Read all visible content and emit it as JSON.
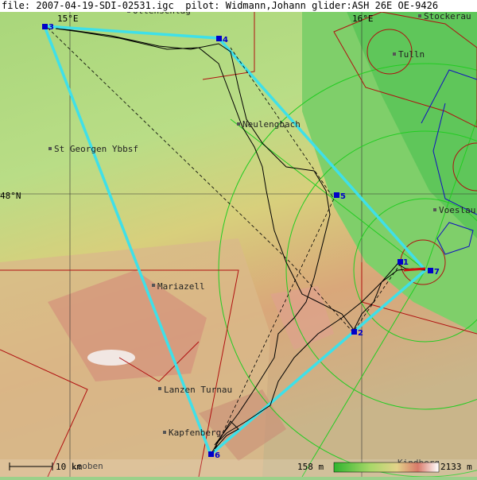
{
  "header": {
    "file_text": "file: 2007-04-19-SDI-02531.igc  pilot: Widmann,Johann glider:ASH 26E OE-9426"
  },
  "coordinates": {
    "lon_15": "15°E",
    "lon_16": "16°E",
    "lat_48": "48°N"
  },
  "towns": [
    {
      "name": "Ottenschlag"
    },
    {
      "name": "Stockerau"
    },
    {
      "name": "Tulln"
    },
    {
      "name": "Neulengbach"
    },
    {
      "name": "St Georgen Ybbsf"
    },
    {
      "name": "Voeslau"
    },
    {
      "name": "Mariazell"
    },
    {
      "name": "Lanzen Turnau"
    },
    {
      "name": "Kapfenberg"
    },
    {
      "name": "Leoben"
    },
    {
      "name": "Kindberg"
    }
  ],
  "turnpoints": [
    {
      "label": "1"
    },
    {
      "label": "2"
    },
    {
      "label": "3"
    },
    {
      "label": "4"
    },
    {
      "label": "5"
    },
    {
      "label": "6"
    },
    {
      "label": "7"
    }
  ],
  "scale": {
    "label": "10 km"
  },
  "elevation_legend": {
    "min_label": "158 m",
    "max_label": "2133 m"
  },
  "colors": {
    "task_line": "#3fe0e8",
    "track": "#000000",
    "turnpoint": "#0000c8",
    "airspace_red": "#b01010",
    "airspace_blue": "#1010c0",
    "airspace_green": "#22cc22",
    "grid": "#333333"
  }
}
